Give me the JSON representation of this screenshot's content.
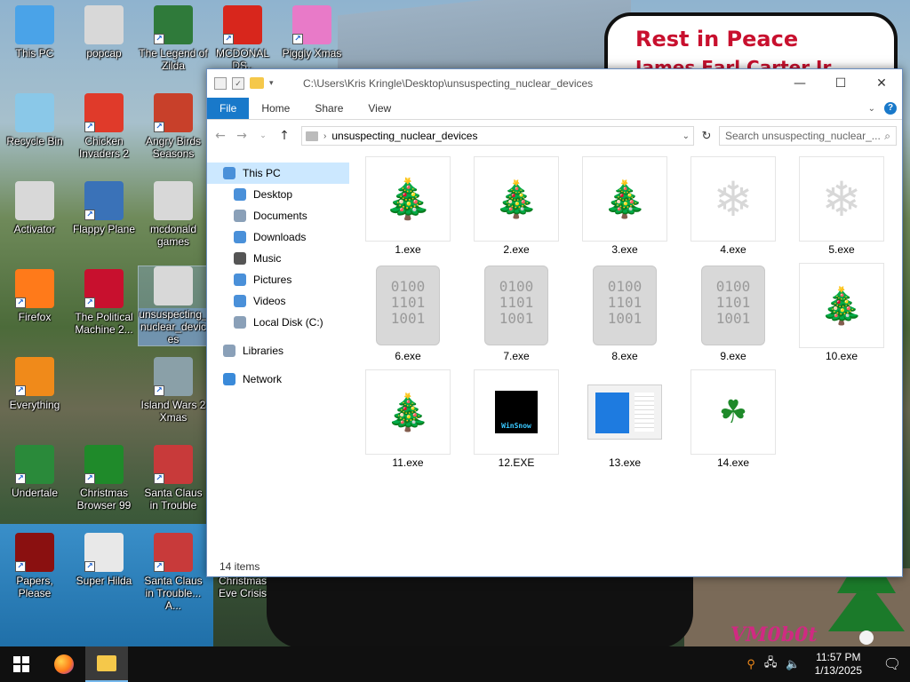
{
  "wallpaper": {
    "sign_line1": "Rest in Peace",
    "sign_line2": "James Earl Carter Jr",
    "watermark": "VM0b0t"
  },
  "desktop_icons": [
    {
      "label": "This PC",
      "icon": "computer-icon",
      "color": "#4aa3e8",
      "shortcut": false
    },
    {
      "label": "popcap",
      "icon": "folder-icon",
      "color": "#d8d8d8",
      "shortcut": false
    },
    {
      "label": "The Legend of Zilda",
      "icon": "zelda-icon",
      "color": "#2f7a3a",
      "shortcut": true
    },
    {
      "label": "MCDONAL DS..",
      "icon": "mcdonalds-icon",
      "color": "#d8261c",
      "shortcut": true
    },
    {
      "label": "Piggly Xmas",
      "icon": "pig-icon",
      "color": "#e87ac8",
      "shortcut": true
    },
    {
      "label": "Recycle Bin",
      "icon": "recycle-bin-icon",
      "color": "#8ac8e8",
      "shortcut": false
    },
    {
      "label": "Chicken Invaders 2",
      "icon": "chicken-icon",
      "color": "#e03a2a",
      "shortcut": true
    },
    {
      "label": "Angry Birds Seasons",
      "icon": "angry-bird-icon",
      "color": "#c8402a",
      "shortcut": true
    },
    {
      "label": "Activator",
      "icon": "folder-icon",
      "color": "#d8d8d8",
      "shortcut": false
    },
    {
      "label": "Flappy Plane",
      "icon": "plane-icon",
      "color": "#3a72b8",
      "shortcut": true
    },
    {
      "label": "mcdonald games",
      "icon": "folder-icon",
      "color": "#d8d8d8",
      "shortcut": false
    },
    {
      "label": "Firefox",
      "icon": "firefox-icon",
      "color": "#ff7a1a",
      "shortcut": true
    },
    {
      "label": "The Political Machine 2...",
      "icon": "political-icon",
      "color": "#c8102e",
      "shortcut": true
    },
    {
      "label": "unsuspecting_nuclear_devices",
      "icon": "folder-icon",
      "color": "#d8d8d8",
      "shortcut": false
    },
    {
      "label": "Everything",
      "icon": "search-icon",
      "color": "#f08a1a",
      "shortcut": true
    },
    {
      "label": "Island Wars 2 Xmas",
      "icon": "island-icon",
      "color": "#8aa0a8",
      "shortcut": true
    },
    {
      "label": "Undertale",
      "icon": "undertale-icon",
      "color": "#2a8a3a",
      "shortcut": true
    },
    {
      "label": "Christmas Browser 99",
      "icon": "xmas-tree-icon",
      "color": "#1f8a2a",
      "shortcut": true
    },
    {
      "label": "Santa Claus in Trouble",
      "icon": "santa-icon",
      "color": "#c83a3a",
      "shortcut": true
    },
    {
      "label": "Papers, Please",
      "icon": "papers-icon",
      "color": "#8a1010",
      "shortcut": true
    },
    {
      "label": "Super Hilda",
      "icon": "hilda-icon",
      "color": "#e8e8e8",
      "shortcut": true
    },
    {
      "label": "Santa Claus in Trouble... A...",
      "icon": "santa-icon",
      "color": "#c83a3a",
      "shortcut": true
    },
    {
      "label": "Christmas Eve Crisis",
      "icon": "blank-icon",
      "color": "#ffffff",
      "shortcut": false
    }
  ],
  "explorer": {
    "title_path": "C:\\Users\\Kris Kringle\\Desktop\\unsuspecting_nuclear_devices",
    "window_buttons": {
      "minimize": "—",
      "maximize": "☐",
      "close": "✕"
    },
    "ribbon_tabs": [
      "File",
      "Home",
      "Share",
      "View"
    ],
    "address": "unsuspecting_nuclear_devices",
    "search_placeholder": "Search unsuspecting_nuclear_...",
    "nav": [
      {
        "label": "This PC",
        "icon": "computer-icon",
        "color": "#4a90d9",
        "selected": true
      },
      {
        "label": "Desktop",
        "icon": "desktop-icon",
        "color": "#4a90d9"
      },
      {
        "label": "Documents",
        "icon": "documents-icon",
        "color": "#8aa0b8"
      },
      {
        "label": "Downloads",
        "icon": "downloads-icon",
        "color": "#4a90d9"
      },
      {
        "label": "Music",
        "icon": "music-icon",
        "color": "#555555"
      },
      {
        "label": "Pictures",
        "icon": "pictures-icon",
        "color": "#4a90d9"
      },
      {
        "label": "Videos",
        "icon": "videos-icon",
        "color": "#4a90d9"
      },
      {
        "label": "Local Disk (C:)",
        "icon": "drive-icon",
        "color": "#8aa0b8"
      },
      {
        "label": "Libraries",
        "icon": "libraries-icon",
        "color": "#8aa0b8"
      },
      {
        "label": "Network",
        "icon": "network-icon",
        "color": "#3a8ad9"
      }
    ],
    "files": [
      {
        "name": "1.exe",
        "icon": "star-tree-icon"
      },
      {
        "name": "2.exe",
        "icon": "xmas-tree-icon"
      },
      {
        "name": "3.exe",
        "icon": "xmas-tree-icon"
      },
      {
        "name": "4.exe",
        "icon": "snowflake-icon"
      },
      {
        "name": "5.exe",
        "icon": "snowflake-icon"
      },
      {
        "name": "6.exe",
        "icon": "binary-file-icon"
      },
      {
        "name": "7.exe",
        "icon": "binary-file-icon"
      },
      {
        "name": "8.exe",
        "icon": "binary-file-icon"
      },
      {
        "name": "9.exe",
        "icon": "binary-file-icon"
      },
      {
        "name": "10.exe",
        "icon": "xmas-tree-icon"
      },
      {
        "name": "11.exe",
        "icon": "xmas-tree-icon"
      },
      {
        "name": "12.EXE",
        "icon": "winsnow-icon"
      },
      {
        "name": "13.exe",
        "icon": "window-app-icon"
      },
      {
        "name": "14.exe",
        "icon": "holly-icon"
      }
    ],
    "binary_text": [
      "0100",
      "1101",
      "1001"
    ],
    "winsnow_text": "WinSnow",
    "status": "14 items"
  },
  "taskbar": {
    "time": "11:57 PM",
    "date": "1/13/2025"
  }
}
